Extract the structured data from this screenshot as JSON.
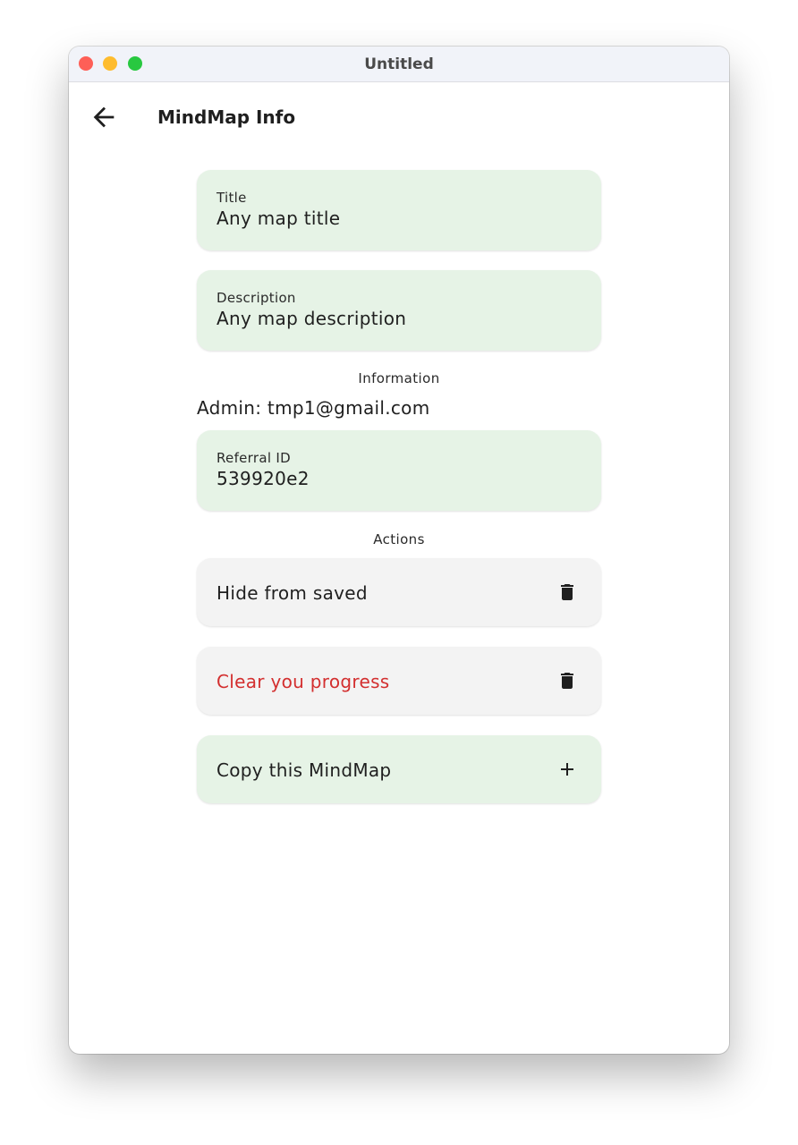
{
  "window": {
    "title": "Untitled"
  },
  "app_bar": {
    "back_icon": "arrow-left-icon",
    "title": "MindMap Info"
  },
  "fields": {
    "title": {
      "label": "Title",
      "value": "Any map title"
    },
    "description": {
      "label": "Description",
      "value": "Any map description"
    },
    "referral": {
      "label": "Referral ID",
      "value": "539920e2"
    }
  },
  "information": {
    "header": "Information",
    "admin": "Admin: tmp1@gmail.com"
  },
  "actions": {
    "header": "Actions",
    "items": [
      {
        "label": "Hide from saved",
        "icon": "trash-icon"
      },
      {
        "label": "Clear you progress",
        "icon": "trash-icon",
        "color": "#d32f2f"
      },
      {
        "label": "Copy this MindMap",
        "icon": "plus-icon"
      }
    ]
  },
  "colors": {
    "field_background": "#e6f3e6",
    "action_background": "#f3f3f3",
    "danger": "#d32f2f"
  }
}
